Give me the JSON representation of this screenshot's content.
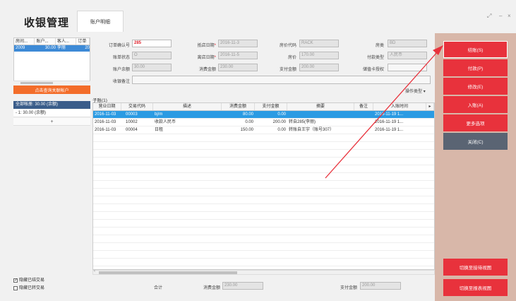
{
  "header": {
    "title": "收银管理",
    "tab": "账户明细",
    "win_controls": [
      "⤢",
      "–",
      "×"
    ]
  },
  "left": {
    "table_headers": [
      "房间...",
      "账户...",
      "客人...",
      "订单"
    ],
    "table_row": [
      "2009",
      "30.00",
      "李丽",
      "20"
    ],
    "query_button": "点击查询关联帐户",
    "account_selected": "全部帐册: 30.00 (余额)",
    "account_row": "-  1: 30.00 (余额)",
    "add_row": "+",
    "checkbox1": "隐藏已结交易",
    "checkbox2": "隐藏已转交易"
  },
  "form": {
    "order_no_label": "订单确认号",
    "order_no": "285",
    "arrival_label": "抵店日期",
    "arrival": "2016-11-3",
    "rate_code_label": "房价代码",
    "rate_code": "RACK",
    "room_type_label": "房类",
    "room_type": "BD",
    "bill_status_label": "账单状态",
    "bill_status": "O",
    "departure_label": "离店日期",
    "departure": "2016-11-5",
    "room_rate_label": "房价",
    "room_rate": "170.00",
    "pay_type_label": "付款类型",
    "pay_type": "人民币",
    "balance_label": "账户余额",
    "balance": "30.00",
    "consumption_label": "消费金额",
    "consumption": "230.00",
    "payment_label": "支付金额",
    "payment": "200.00",
    "card_auth_label": "储值卡授权",
    "card_auth": "",
    "remark_label": "收银备注",
    "remark": "",
    "op_type_label": "操作类型"
  },
  "transactions": {
    "section_label": "子账(1)",
    "headers": [
      "营业日期",
      "交易代码",
      "描述",
      "消费金额",
      "支付金额",
      "摘要",
      "备注",
      "入账时间"
    ],
    "rows": [
      [
        "2016-11-03",
        "00003",
        "bj/m",
        "80.00",
        "0.00",
        "",
        "",
        "2016-11-19 1..."
      ],
      [
        "2016-11-03",
        "10002",
        "收款人民币",
        "0.00",
        "200.00",
        "转自285(李丽)",
        "",
        "2016-11-19 1..."
      ],
      [
        "2016-11-03",
        "00004",
        "日租",
        "150.00",
        "0.00",
        "转账自王宇（账号307）",
        "",
        "2016-11-19 1..."
      ]
    ]
  },
  "footer": {
    "total_label": "合计",
    "consumption_label": "消费金额",
    "consumption": "230.00",
    "payment_label": "支付金额",
    "payment": "200.00"
  },
  "actions": {
    "checkout": "结账(S)",
    "pay": "付款(P)",
    "modify": "修改(E)",
    "post": "入账(A)",
    "more": "更多选项",
    "close": "关闭(C)",
    "switch_reception": "切换至接待视图",
    "switch_report": "切换至报表视图"
  },
  "colors": {
    "accent_red": "#e8323c",
    "select_blue": "#2b9be3",
    "orange": "#f36d2a",
    "panel_bg": "#d8b7a9",
    "dark_btn": "#5a6473"
  }
}
